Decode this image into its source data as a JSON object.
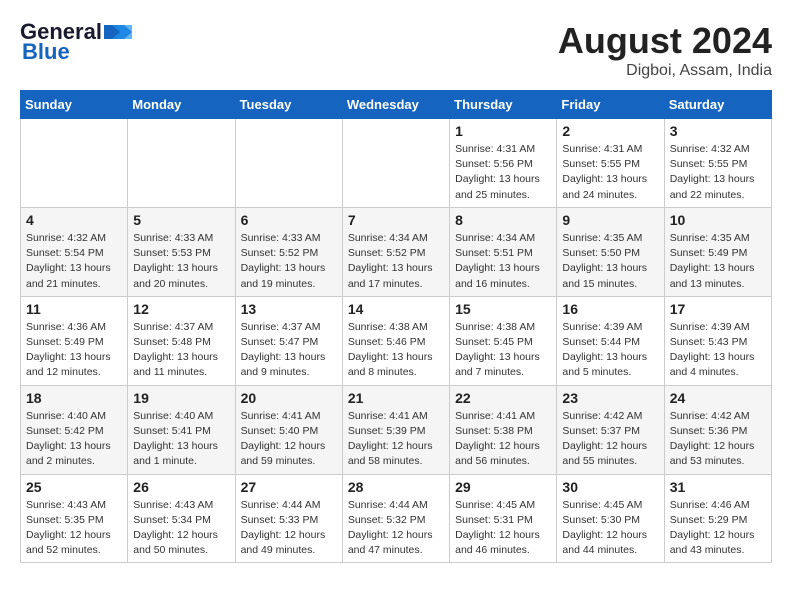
{
  "header": {
    "logo_line1": "General",
    "logo_line2": "Blue",
    "month_year": "August 2024",
    "location": "Digboi, Assam, India"
  },
  "days_of_week": [
    "Sunday",
    "Monday",
    "Tuesday",
    "Wednesday",
    "Thursday",
    "Friday",
    "Saturday"
  ],
  "weeks": [
    [
      {
        "day": "",
        "info": ""
      },
      {
        "day": "",
        "info": ""
      },
      {
        "day": "",
        "info": ""
      },
      {
        "day": "",
        "info": ""
      },
      {
        "day": "1",
        "info": "Sunrise: 4:31 AM\nSunset: 5:56 PM\nDaylight: 13 hours\nand 25 minutes."
      },
      {
        "day": "2",
        "info": "Sunrise: 4:31 AM\nSunset: 5:55 PM\nDaylight: 13 hours\nand 24 minutes."
      },
      {
        "day": "3",
        "info": "Sunrise: 4:32 AM\nSunset: 5:55 PM\nDaylight: 13 hours\nand 22 minutes."
      }
    ],
    [
      {
        "day": "4",
        "info": "Sunrise: 4:32 AM\nSunset: 5:54 PM\nDaylight: 13 hours\nand 21 minutes."
      },
      {
        "day": "5",
        "info": "Sunrise: 4:33 AM\nSunset: 5:53 PM\nDaylight: 13 hours\nand 20 minutes."
      },
      {
        "day": "6",
        "info": "Sunrise: 4:33 AM\nSunset: 5:52 PM\nDaylight: 13 hours\nand 19 minutes."
      },
      {
        "day": "7",
        "info": "Sunrise: 4:34 AM\nSunset: 5:52 PM\nDaylight: 13 hours\nand 17 minutes."
      },
      {
        "day": "8",
        "info": "Sunrise: 4:34 AM\nSunset: 5:51 PM\nDaylight: 13 hours\nand 16 minutes."
      },
      {
        "day": "9",
        "info": "Sunrise: 4:35 AM\nSunset: 5:50 PM\nDaylight: 13 hours\nand 15 minutes."
      },
      {
        "day": "10",
        "info": "Sunrise: 4:35 AM\nSunset: 5:49 PM\nDaylight: 13 hours\nand 13 minutes."
      }
    ],
    [
      {
        "day": "11",
        "info": "Sunrise: 4:36 AM\nSunset: 5:49 PM\nDaylight: 13 hours\nand 12 minutes."
      },
      {
        "day": "12",
        "info": "Sunrise: 4:37 AM\nSunset: 5:48 PM\nDaylight: 13 hours\nand 11 minutes."
      },
      {
        "day": "13",
        "info": "Sunrise: 4:37 AM\nSunset: 5:47 PM\nDaylight: 13 hours\nand 9 minutes."
      },
      {
        "day": "14",
        "info": "Sunrise: 4:38 AM\nSunset: 5:46 PM\nDaylight: 13 hours\nand 8 minutes."
      },
      {
        "day": "15",
        "info": "Sunrise: 4:38 AM\nSunset: 5:45 PM\nDaylight: 13 hours\nand 7 minutes."
      },
      {
        "day": "16",
        "info": "Sunrise: 4:39 AM\nSunset: 5:44 PM\nDaylight: 13 hours\nand 5 minutes."
      },
      {
        "day": "17",
        "info": "Sunrise: 4:39 AM\nSunset: 5:43 PM\nDaylight: 13 hours\nand 4 minutes."
      }
    ],
    [
      {
        "day": "18",
        "info": "Sunrise: 4:40 AM\nSunset: 5:42 PM\nDaylight: 13 hours\nand 2 minutes."
      },
      {
        "day": "19",
        "info": "Sunrise: 4:40 AM\nSunset: 5:41 PM\nDaylight: 13 hours\nand 1 minute."
      },
      {
        "day": "20",
        "info": "Sunrise: 4:41 AM\nSunset: 5:40 PM\nDaylight: 12 hours\nand 59 minutes."
      },
      {
        "day": "21",
        "info": "Sunrise: 4:41 AM\nSunset: 5:39 PM\nDaylight: 12 hours\nand 58 minutes."
      },
      {
        "day": "22",
        "info": "Sunrise: 4:41 AM\nSunset: 5:38 PM\nDaylight: 12 hours\nand 56 minutes."
      },
      {
        "day": "23",
        "info": "Sunrise: 4:42 AM\nSunset: 5:37 PM\nDaylight: 12 hours\nand 55 minutes."
      },
      {
        "day": "24",
        "info": "Sunrise: 4:42 AM\nSunset: 5:36 PM\nDaylight: 12 hours\nand 53 minutes."
      }
    ],
    [
      {
        "day": "25",
        "info": "Sunrise: 4:43 AM\nSunset: 5:35 PM\nDaylight: 12 hours\nand 52 minutes."
      },
      {
        "day": "26",
        "info": "Sunrise: 4:43 AM\nSunset: 5:34 PM\nDaylight: 12 hours\nand 50 minutes."
      },
      {
        "day": "27",
        "info": "Sunrise: 4:44 AM\nSunset: 5:33 PM\nDaylight: 12 hours\nand 49 minutes."
      },
      {
        "day": "28",
        "info": "Sunrise: 4:44 AM\nSunset: 5:32 PM\nDaylight: 12 hours\nand 47 minutes."
      },
      {
        "day": "29",
        "info": "Sunrise: 4:45 AM\nSunset: 5:31 PM\nDaylight: 12 hours\nand 46 minutes."
      },
      {
        "day": "30",
        "info": "Sunrise: 4:45 AM\nSunset: 5:30 PM\nDaylight: 12 hours\nand 44 minutes."
      },
      {
        "day": "31",
        "info": "Sunrise: 4:46 AM\nSunset: 5:29 PM\nDaylight: 12 hours\nand 43 minutes."
      }
    ]
  ]
}
